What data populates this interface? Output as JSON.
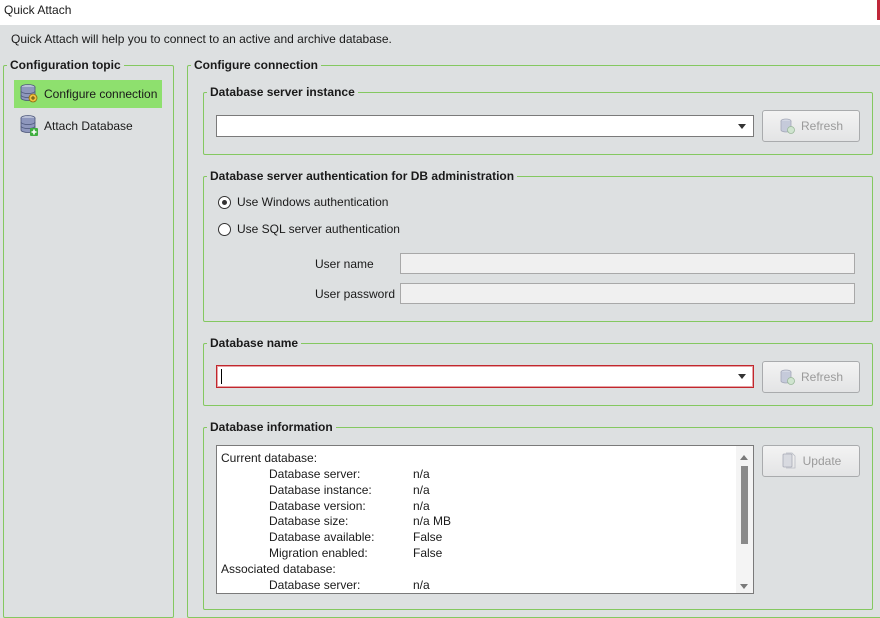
{
  "window": {
    "title": "Quick Attach"
  },
  "intro": "Quick Attach will help you to connect to an active and archive database.",
  "topics": {
    "legend": "Configuration topic",
    "items": [
      {
        "label": "Configure connection",
        "icon": "database-connect-icon",
        "active": true
      },
      {
        "label": "Attach Database",
        "icon": "database-add-icon",
        "active": false
      }
    ]
  },
  "configure": {
    "legend": "Configure connection",
    "server_instance": {
      "legend": "Database server instance",
      "value": "",
      "refresh_label": "Refresh"
    },
    "auth": {
      "legend": "Database server authentication for DB administration",
      "windows_label": "Use Windows authentication",
      "sql_label": "Use SQL server authentication",
      "selected": "windows",
      "user_name_label": "User name",
      "user_password_label": "User password",
      "user_name_value": "",
      "user_password_value": ""
    },
    "db_name": {
      "legend": "Database name",
      "value": "",
      "refresh_label": "Refresh"
    },
    "db_info": {
      "legend": "Database information",
      "update_label": "Update",
      "current_header": "Current database:",
      "current_rows": [
        {
          "key": "Database server:",
          "value": "n/a"
        },
        {
          "key": "Database instance:",
          "value": "n/a"
        },
        {
          "key": "Database version:",
          "value": "n/a"
        },
        {
          "key": "Database size:",
          "value": "n/a MB"
        },
        {
          "key": "Database available:",
          "value": "False"
        },
        {
          "key": "Migration enabled:",
          "value": "False"
        }
      ],
      "associated_header": "Associated database:",
      "associated_rows": [
        {
          "key": "Database server:",
          "value": "n/a"
        }
      ]
    }
  },
  "colors": {
    "accent_green": "#8ee06e",
    "group_border": "#84c860",
    "invalid_border": "#c1272d",
    "window_bg": "#dde0e1"
  }
}
